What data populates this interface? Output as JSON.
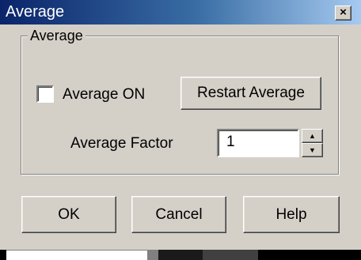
{
  "window": {
    "title": "Average",
    "close_glyph": "×"
  },
  "group": {
    "legend": "Average",
    "average_on": {
      "label": "Average ON",
      "checked": false
    },
    "restart_label": "Restart Average",
    "factor": {
      "label": "Average Factor",
      "value": "1"
    }
  },
  "buttons": {
    "ok": "OK",
    "cancel": "Cancel",
    "help": "Help"
  },
  "icons": {
    "close": "close-icon",
    "spin_up": "up-arrow-icon",
    "spin_down": "down-arrow-icon"
  },
  "colors": {
    "title_start": "#0a246a",
    "title_end": "#a6caf0",
    "face": "#d4d0c8"
  }
}
